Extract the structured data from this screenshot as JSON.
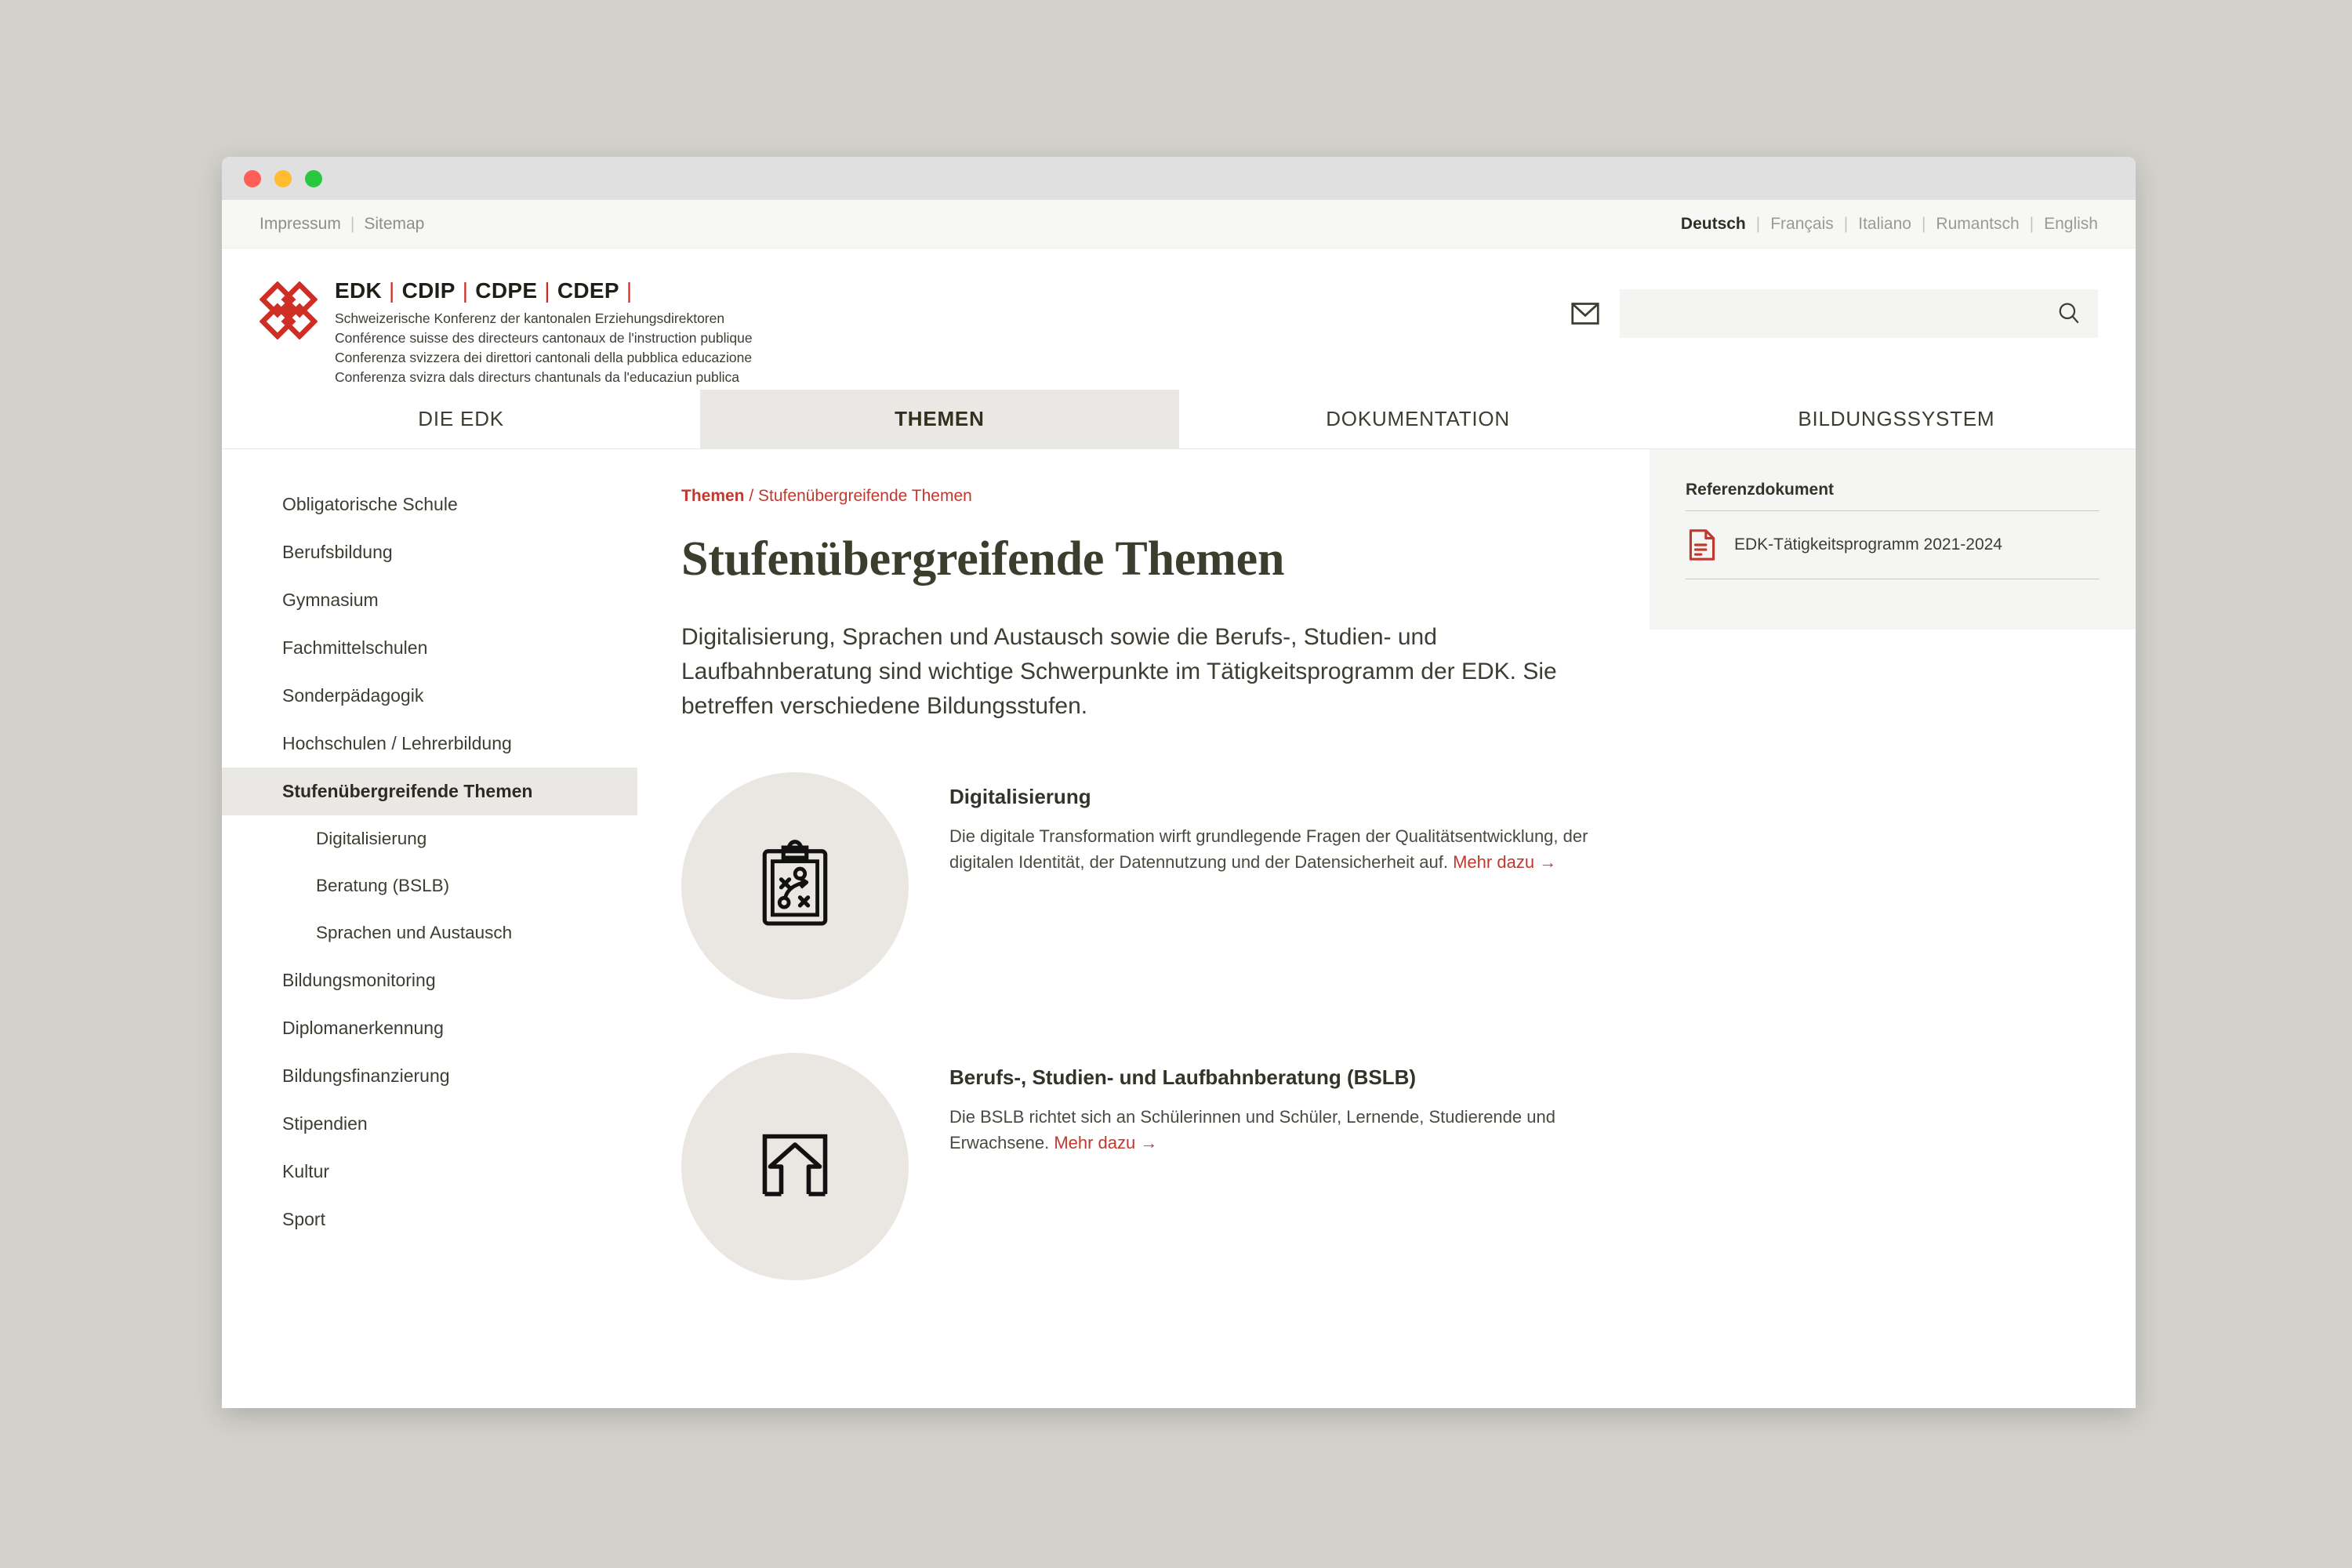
{
  "window": {
    "traffic_lights": [
      "close",
      "minimize",
      "maximize"
    ]
  },
  "utility_bar": {
    "links": [
      "Impressum",
      "Sitemap"
    ],
    "separator": "|",
    "languages": [
      {
        "label": "Deutsch",
        "active": true
      },
      {
        "label": "Français",
        "active": false
      },
      {
        "label": "Italiano",
        "active": false
      },
      {
        "label": "Rumantsch",
        "active": false
      },
      {
        "label": "English",
        "active": false
      }
    ]
  },
  "masthead": {
    "logo_icon": "edk-logo-icon",
    "acronyms": [
      "EDK",
      "CDIP",
      "CDPE",
      "CDEP"
    ],
    "acronym_separator": "|",
    "org_names": [
      "Schweizerische Konferenz der kantonalen Erziehungsdirektoren",
      "Conférence suisse des directeurs cantonaux de l'instruction publique",
      "Conferenza svizzera dei direttori cantonali della pubblica educazione",
      "Conferenza svizra dals directurs chantunals da l'educaziun publica"
    ],
    "mail_icon": "envelope-icon",
    "search": {
      "value": "",
      "placeholder": "",
      "icon": "search-icon"
    }
  },
  "main_nav": {
    "tabs": [
      {
        "label": "DIE EDK",
        "active": false
      },
      {
        "label": "THEMEN",
        "active": true
      },
      {
        "label": "DOKUMENTATION",
        "active": false
      },
      {
        "label": "BILDUNGSSYSTEM",
        "active": false
      }
    ]
  },
  "sidebar": {
    "items": [
      {
        "label": "Obligatorische Schule",
        "active": false,
        "sub": false
      },
      {
        "label": "Berufsbildung",
        "active": false,
        "sub": false
      },
      {
        "label": "Gymnasium",
        "active": false,
        "sub": false
      },
      {
        "label": "Fachmittelschulen",
        "active": false,
        "sub": false
      },
      {
        "label": "Sonderpädagogik",
        "active": false,
        "sub": false
      },
      {
        "label": "Hochschulen / Lehrerbildung",
        "active": false,
        "sub": false
      },
      {
        "label": "Stufenübergreifende Themen",
        "active": true,
        "sub": false
      },
      {
        "label": "Digitalisierung",
        "active": false,
        "sub": true
      },
      {
        "label": "Beratung (BSLB)",
        "active": false,
        "sub": true
      },
      {
        "label": "Sprachen und Austausch",
        "active": false,
        "sub": true
      },
      {
        "label": "Bildungsmonitoring",
        "active": false,
        "sub": false
      },
      {
        "label": "Diplomanerkennung",
        "active": false,
        "sub": false
      },
      {
        "label": "Bildungsfinanzierung",
        "active": false,
        "sub": false
      },
      {
        "label": "Stipendien",
        "active": false,
        "sub": false
      },
      {
        "label": "Kultur",
        "active": false,
        "sub": false
      },
      {
        "label": "Sport",
        "active": false,
        "sub": false
      }
    ]
  },
  "main": {
    "breadcrumb": {
      "parent": "Themen",
      "separator": " / ",
      "current": "Stufenübergreifende Themen"
    },
    "title": "Stufenübergreifende Themen",
    "intro": "Digitalisierung, Sprachen und Austausch sowie die Berufs-, Studien- und Laufbahnberatung sind wichtige Schwerpunkte im Tätigkeitsprogramm der EDK. Sie betreffen verschiedene Bildungsstufen.",
    "topics": [
      {
        "icon": "clipboard-strategy-icon",
        "title": "Digitalisierung",
        "description": "Die digitale Transformation wirft grundlegende Fragen der Qualitätsentwicklung, der digitalen Identität, der Datennutzung und der Datensicherheit auf.",
        "link_label": "Mehr dazu",
        "link_arrow": "→"
      },
      {
        "icon": "arrow-up-in-square-icon",
        "title": "Berufs-, Studien- und Laufbahnberatung (BSLB)",
        "description": "Die BSLB richtet sich an Schülerinnen und Schüler, Lernende, Studierende und Erwachsene.",
        "link_label": "Mehr dazu",
        "link_arrow": "→"
      }
    ]
  },
  "right_rail": {
    "panel_title": "Referenzdokument",
    "documents": [
      {
        "icon": "pdf-document-icon",
        "label": "EDK-Tätigkeitsprogramm 2021-2024"
      }
    ]
  },
  "colors": {
    "brand_red": "#cf2e25",
    "link_red": "#c0392f",
    "text_dark": "#3d3d33",
    "active_bg": "#eae8e4",
    "page_bg": "#d3d1cb",
    "panel_bg": "#f5f5f4"
  }
}
